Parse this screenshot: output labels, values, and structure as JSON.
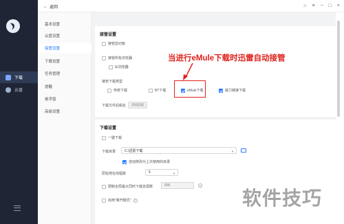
{
  "rail": {
    "items": [
      {
        "label": "下载"
      },
      {
        "label": "云盘"
      }
    ]
  },
  "topbar": {
    "back_label": "返回"
  },
  "subnav": {
    "items": [
      {
        "label": "基本设置"
      },
      {
        "label": "云盘设置"
      },
      {
        "label": "接管设置"
      },
      {
        "label": "下载设置"
      },
      {
        "label": "任务管理"
      },
      {
        "label": "提醒"
      },
      {
        "label": "悬浮窗"
      },
      {
        "label": "高级设置"
      }
    ]
  },
  "takeover": {
    "title": "接管设置",
    "clipboard": "接管剪切板",
    "all_browsers": "接管所有浏览器",
    "ie_browser": "IE浏览器",
    "type_label": "接管下载类型",
    "types": [
      {
        "label": "传统下载",
        "checked": false
      },
      {
        "label": "BT下载",
        "checked": false
      },
      {
        "label": "eMule下载",
        "checked": true
      },
      {
        "label": "磁力链接下载",
        "checked": true
      }
    ],
    "ext_label": "下载文件后缀名",
    "ext_button": "添加后缀"
  },
  "download": {
    "title": "下载设置",
    "one_click": "一键下载",
    "dir_label": "下载目录",
    "dir_value": "C:\\迅雷下载",
    "auto_change": "自动修改为上次使用的目录",
    "threads_label": "原始地址线程数",
    "threads_value": "5",
    "limit_label": "限制全局最大同时下载资源数",
    "limit_value": "500",
    "open_mode": "启用\"离开模式\""
  },
  "annotation": {
    "text": "当进行eMule下载时迅雷自动接管"
  },
  "watermark": {
    "text": "软件技巧"
  }
}
